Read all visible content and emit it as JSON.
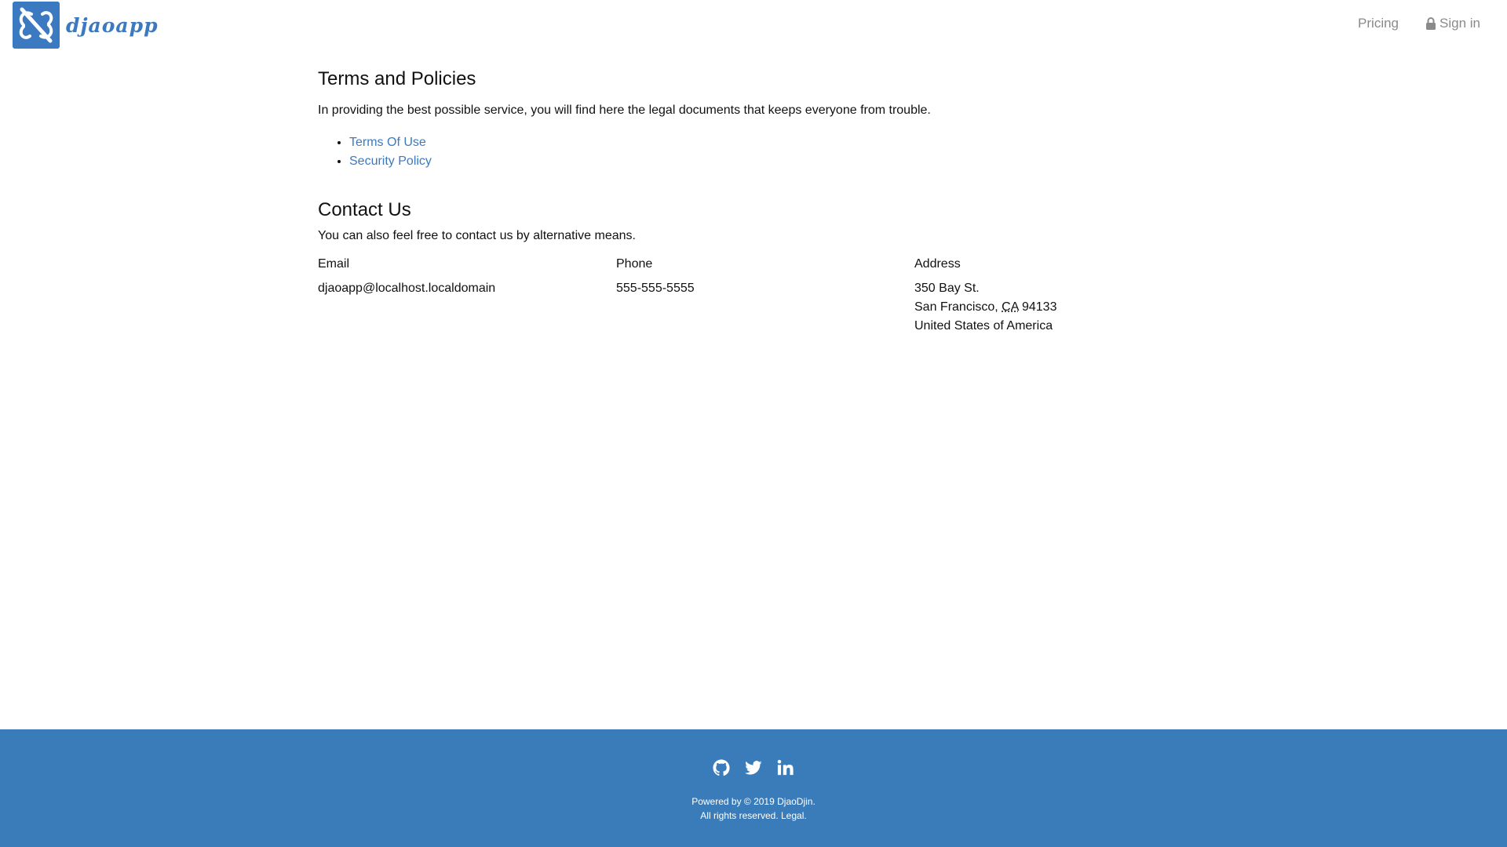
{
  "header": {
    "brand_name": "djaoapp",
    "nav": {
      "pricing": "Pricing",
      "sign_in": "Sign in"
    }
  },
  "terms": {
    "title": "Terms and Policies",
    "intro": "In providing the best possible service, you will find here the legal documents that keeps everyone from trouble.",
    "links": [
      "Terms Of Use",
      "Security Policy"
    ]
  },
  "contact": {
    "title": "Contact Us",
    "intro": "You can also feel free to contact us by alternative means.",
    "email": {
      "label": "Email",
      "value": "djaoapp@localhost.localdomain"
    },
    "phone": {
      "label": "Phone",
      "value": "555-555-5555"
    },
    "address": {
      "label": "Address",
      "street": "350 Bay St.",
      "city": "San Francisco,",
      "region": "CA",
      "postal": "94133",
      "country": "United States of America"
    }
  },
  "footer": {
    "powered_by": "Powered by © 2019 DjaoDjin.",
    "rights": "All rights reserved.",
    "legal": "Legal.",
    "social_icons": [
      "github-icon",
      "twitter-icon",
      "linkedin-icon"
    ]
  },
  "colors": {
    "brand": "#3b7ac0",
    "footer_bg": "#3a7cba",
    "link": "#3b7ac0",
    "nav_text": "#8a8a8a"
  }
}
